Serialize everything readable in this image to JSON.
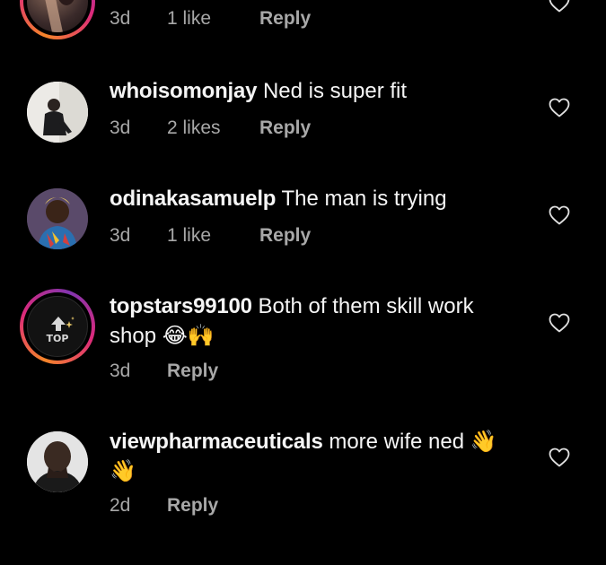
{
  "comments": [
    {
      "username": "",
      "text": "",
      "time": "3d",
      "likes": "1 like",
      "reply": "Reply"
    },
    {
      "username": "whoisomonjay",
      "text": "Ned is super fit",
      "time": "3d",
      "likes": "2 likes",
      "reply": "Reply"
    },
    {
      "username": "odinakasamuelp",
      "text": "The man is trying",
      "time": "3d",
      "likes": "1 like",
      "reply": "Reply"
    },
    {
      "username": "topstars99100",
      "text": "Both of them skill work shop",
      "emoji": "😂🙌",
      "avatar_badge": "TOP",
      "time": "3d",
      "reply": "Reply"
    },
    {
      "username": "viewpharmaceuticals",
      "text": "more wife ned",
      "emoji_a": "👋",
      "emoji_b": "👋",
      "time": "2d",
      "reply": "Reply"
    }
  ],
  "icons": {
    "like": "heart-outline-icon"
  },
  "colors": {
    "background": "#000000",
    "text": "#f5f5f5",
    "meta": "#a8a8a8",
    "story_ring_start": "#f58529",
    "story_ring_end": "#8134af"
  }
}
